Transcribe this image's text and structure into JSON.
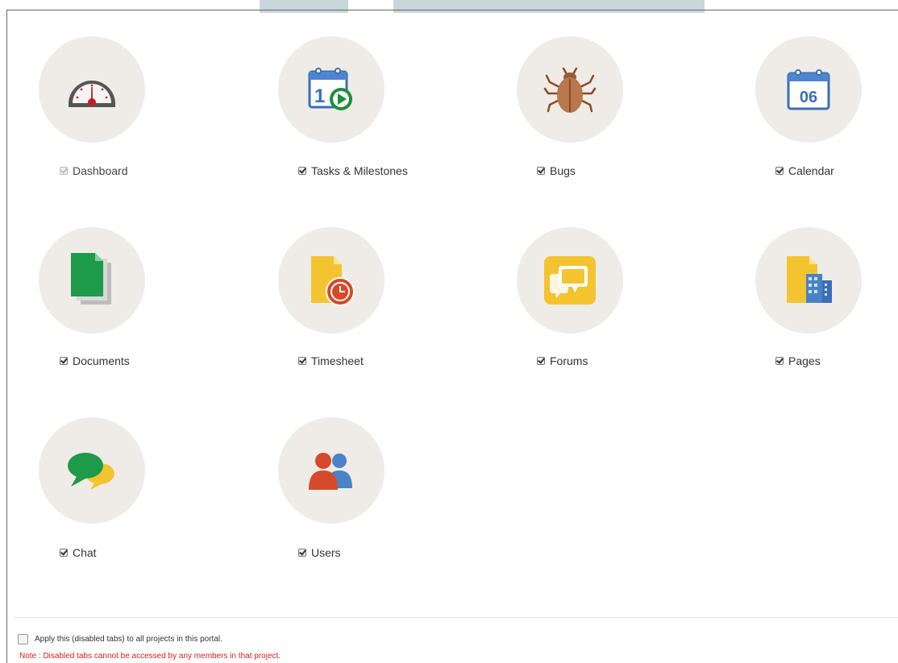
{
  "modules": [
    {
      "id": "dashboard",
      "label": "Dashboard",
      "checked": true,
      "disabled": true,
      "icon": "dashboard-gauge-icon"
    },
    {
      "id": "tasks",
      "label": "Tasks & Milestones",
      "checked": true,
      "disabled": false,
      "icon": "calendar-play-icon"
    },
    {
      "id": "bugs",
      "label": "Bugs",
      "checked": true,
      "disabled": false,
      "icon": "bug-icon"
    },
    {
      "id": "calendar",
      "label": "Calendar",
      "checked": true,
      "disabled": false,
      "icon": "calendar-icon",
      "calendar_day": "06"
    },
    {
      "id": "documents",
      "label": "Documents",
      "checked": true,
      "disabled": false,
      "icon": "documents-icon"
    },
    {
      "id": "timesheet",
      "label": "Timesheet",
      "checked": true,
      "disabled": false,
      "icon": "timesheet-clock-icon"
    },
    {
      "id": "forums",
      "label": "Forums",
      "checked": true,
      "disabled": false,
      "icon": "forums-speech-icon"
    },
    {
      "id": "pages",
      "label": "Pages",
      "checked": true,
      "disabled": false,
      "icon": "pages-building-icon"
    },
    {
      "id": "chat",
      "label": "Chat",
      "checked": true,
      "disabled": false,
      "icon": "chat-bubbles-icon"
    },
    {
      "id": "users",
      "label": "Users",
      "checked": true,
      "disabled": false,
      "icon": "users-icon"
    }
  ],
  "apply_all": {
    "label": "Apply this (disabled tabs) to all projects in this portal.",
    "checked": false
  },
  "note": "Note : Disabled tabs cannot be accessed by any members in that project.",
  "colors": {
    "circle_bg": "#efece7",
    "note_red": "#d9221e"
  }
}
